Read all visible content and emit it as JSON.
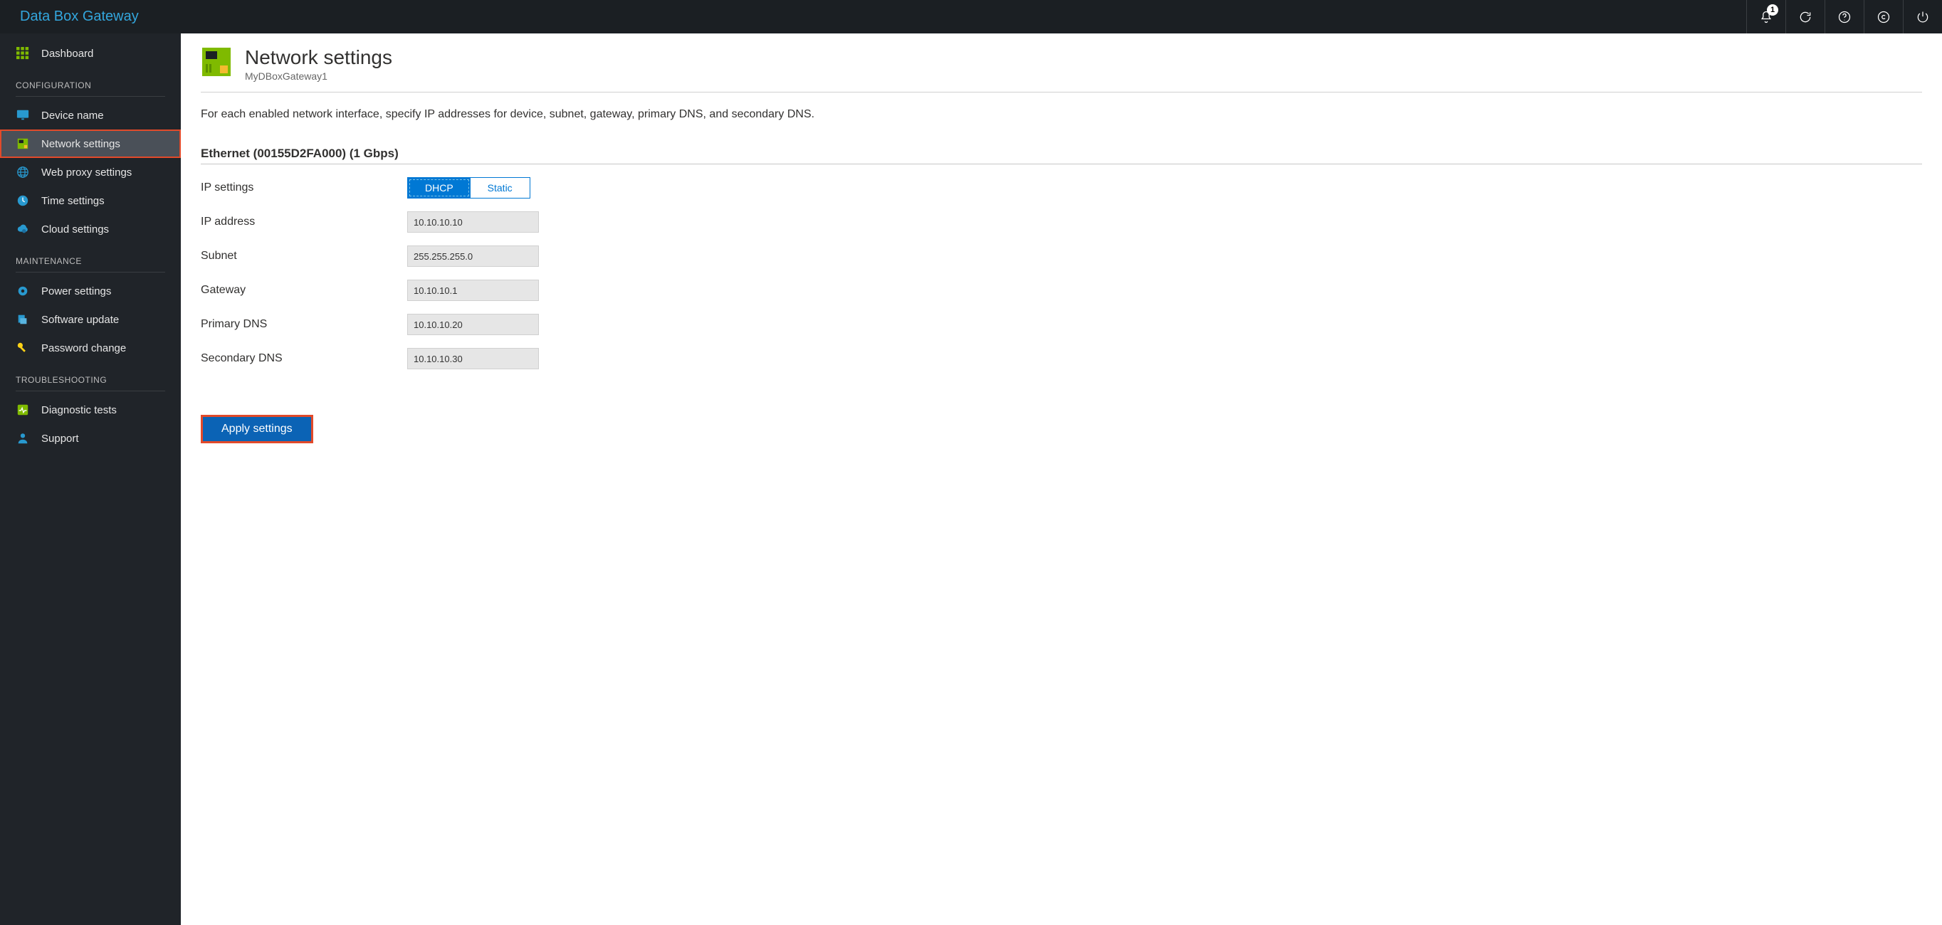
{
  "topbar": {
    "title": "Data Box Gateway",
    "notify_count": "1"
  },
  "sidebar": {
    "dashboard": "Dashboard",
    "section_config": "CONFIGURATION",
    "device_name": "Device name",
    "network_settings": "Network settings",
    "web_proxy": "Web proxy settings",
    "time_settings": "Time settings",
    "cloud_settings": "Cloud settings",
    "section_maint": "MAINTENANCE",
    "power_settings": "Power settings",
    "software_update": "Software update",
    "password_change": "Password change",
    "section_trouble": "TROUBLESHOOTING",
    "diagnostic_tests": "Diagnostic tests",
    "support": "Support"
  },
  "page": {
    "title": "Network settings",
    "subtitle": "MyDBoxGateway1",
    "intro": "For each enabled network interface, specify IP addresses for device, subnet, gateway, primary DNS, and secondary DNS.",
    "interface_heading": "Ethernet (00155D2FA000) (1 Gbps)",
    "labels": {
      "ip_settings": "IP settings",
      "ip_address": "IP address",
      "subnet": "Subnet",
      "gateway": "Gateway",
      "primary_dns": "Primary DNS",
      "secondary_dns": "Secondary DNS"
    },
    "toggle": {
      "dhcp": "DHCP",
      "static": "Static"
    },
    "values": {
      "ip_address": "10.10.10.10",
      "subnet": "255.255.255.0",
      "gateway": "10.10.10.1",
      "primary_dns": "10.10.10.20",
      "secondary_dns": "10.10.10.30"
    },
    "apply_label": "Apply settings"
  }
}
